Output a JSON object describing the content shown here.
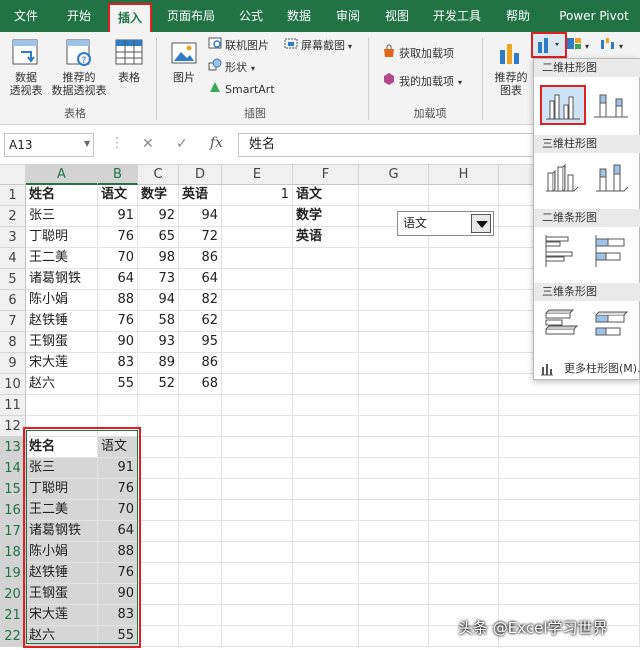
{
  "tabs": [
    "文件",
    "开始",
    "插入",
    "页面布局",
    "公式",
    "数据",
    "审阅",
    "视图",
    "开发工具",
    "帮助",
    "Power Pivot"
  ],
  "ribbon": {
    "pivot_table_label": "数据\n透视表",
    "recommended_pivot_label": "推荐的\n数据透视表",
    "table_label": "表格",
    "group_tables": "表格",
    "picture_label": "图片",
    "online_pictures": "联机图片",
    "shapes": "形状",
    "smartart": "SmartArt",
    "screenshot": "屏幕截图",
    "group_illustrations": "插图",
    "get_addins": "获取加载项",
    "my_addins": "我的加载项",
    "group_addins": "加载项",
    "recommended_charts_label": "推荐的\n图表"
  },
  "formula_bar": {
    "name_box": "A13",
    "cancel": "✕",
    "enter": "✓",
    "fx": "fx",
    "content": "姓名"
  },
  "columns": [
    "A",
    "B",
    "C",
    "D",
    "E",
    "F",
    "G",
    "H"
  ],
  "rows": [
    "1",
    "2",
    "3",
    "4",
    "5",
    "6",
    "7",
    "8",
    "9",
    "10",
    "11",
    "12",
    "13",
    "14",
    "15",
    "16",
    "17",
    "18",
    "19",
    "20",
    "21",
    "22"
  ],
  "main_table": {
    "headers": [
      "姓名",
      "语文",
      "数学",
      "英语"
    ],
    "rows": [
      [
        "张三",
        "91",
        "92",
        "94"
      ],
      [
        "丁聪明",
        "76",
        "65",
        "72"
      ],
      [
        "王二美",
        "70",
        "98",
        "86"
      ],
      [
        "诸葛钢铁",
        "64",
        "73",
        "64"
      ],
      [
        "陈小娟",
        "88",
        "94",
        "82"
      ],
      [
        "赵铁锤",
        "76",
        "58",
        "62"
      ],
      [
        "王钢蛋",
        "90",
        "93",
        "95"
      ],
      [
        "宋大莲",
        "83",
        "89",
        "86"
      ],
      [
        "赵六",
        "55",
        "52",
        "68"
      ]
    ]
  },
  "e1_value": "1",
  "subject_list": [
    "语文",
    "数学",
    "英语"
  ],
  "dropdown_value": "语文",
  "selected_table": {
    "headers": [
      "姓名",
      "语文"
    ],
    "rows": [
      [
        "张三",
        "91"
      ],
      [
        "丁聪明",
        "76"
      ],
      [
        "王二美",
        "70"
      ],
      [
        "诸葛钢铁",
        "64"
      ],
      [
        "陈小娟",
        "88"
      ],
      [
        "赵铁锤",
        "76"
      ],
      [
        "王钢蛋",
        "90"
      ],
      [
        "宋大莲",
        "83"
      ],
      [
        "赵六",
        "55"
      ]
    ]
  },
  "chart_panel": {
    "section_2d_column": "二维柱形图",
    "section_3d_column": "三维柱形图",
    "section_2d_bar": "二维条形图",
    "section_3d_bar": "三维条形图",
    "more_label": "更多柱形图(M)..."
  },
  "watermark": "头条 @Excel学习世界",
  "colors": {
    "excel_green": "#217346",
    "highlight_red": "#e02020",
    "selection_gray": "#d6d6d6"
  }
}
